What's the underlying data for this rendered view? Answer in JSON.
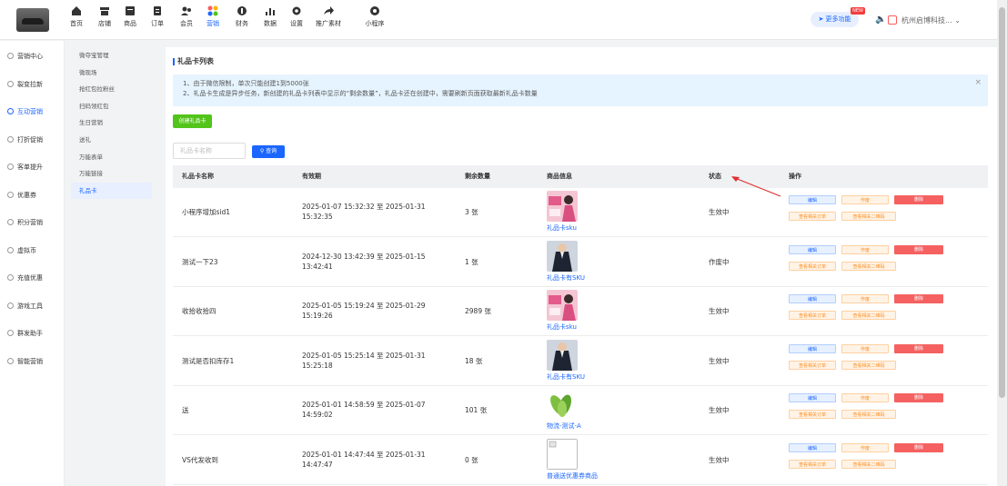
{
  "topnav": {
    "items": [
      {
        "label": "首页",
        "icon": "home-icon"
      },
      {
        "label": "店铺",
        "icon": "store-icon"
      },
      {
        "label": "商品",
        "icon": "goods-icon"
      },
      {
        "label": "订单",
        "icon": "order-icon"
      },
      {
        "label": "会员",
        "icon": "member-icon"
      },
      {
        "label": "营销",
        "icon": "marketing-icon"
      },
      {
        "label": "财务",
        "icon": "finance-icon"
      },
      {
        "label": "数据",
        "icon": "data-icon"
      },
      {
        "label": "设置",
        "icon": "settings-icon"
      },
      {
        "label": "推广素材",
        "icon": "share-icon"
      },
      {
        "label": "小程序",
        "icon": "miniprogram-icon"
      }
    ],
    "active_index": 5,
    "more_label": "更多功能",
    "new_badge": "NEW",
    "shop_name": "杭州启博科技..."
  },
  "sidebar": {
    "items": [
      "营销中心",
      "裂变拉新",
      "互动营销",
      "打折促销",
      "客单提升",
      "优惠券",
      "积分营销",
      "虚拟币",
      "充值优惠",
      "游戏工具",
      "群发助手",
      "智能营销"
    ],
    "active_index": 2
  },
  "subnav": {
    "items": [
      "微夺宝管理",
      "微现场",
      "抢红包拉粉丝",
      "扫码领红包",
      "生日营销",
      "送礼",
      "万能表单",
      "万能链接",
      "礼品卡"
    ],
    "active_index": 8
  },
  "page": {
    "title": "礼品卡列表",
    "notice_line1": "1、由于微信限制，单次只能创建1到5000张",
    "notice_line2": "2、礼品卡生成是异步任务，新创建的礼品卡列表中显示的“剩余数量”，礼品卡还在创建中，需要刷新页面获取最新礼品卡数量",
    "create_button": "创建礼品卡",
    "search_placeholder": "礼品卡名称",
    "search_button": "查询"
  },
  "table": {
    "headers": [
      "礼品卡名称",
      "有效期",
      "剩余数量",
      "商品信息",
      "状态",
      "操作"
    ],
    "action_labels": {
      "edit": "编辑",
      "void": "作废",
      "delete": "删除",
      "orders": "查看相关订单",
      "qr": "查看相关二维码"
    },
    "rows": [
      {
        "name": "小程序增加sid1",
        "validity": "2025-01-07 15:32:32 至 2025-01-31 15:32:35",
        "quantity": "3 张",
        "product": "礼品卡sku",
        "thumb": "pink-model",
        "status": "生效中"
      },
      {
        "name": "测试一下23",
        "validity": "2024-12-30 13:42:39 至 2025-01-15 13:42:41",
        "quantity": "1 张",
        "product": "礼品卡有SKU",
        "thumb": "dark-suit",
        "status": "作废中"
      },
      {
        "name": "收拾收拾四",
        "validity": "2025-01-05 15:19:24 至 2025-01-29 15:19:26",
        "quantity": "2989 张",
        "product": "礼品卡sku",
        "thumb": "pink-model",
        "status": "生效中"
      },
      {
        "name": "测试是否扣库存1",
        "validity": "2025-01-05 15:25:14 至 2025-01-31 15:25:18",
        "quantity": "18 张",
        "product": "礼品卡有SKU",
        "thumb": "dark-suit",
        "status": "生效中"
      },
      {
        "name": "送",
        "validity": "2025-01-01 14:58:59 至 2025-01-07 14:59:02",
        "quantity": "101 张",
        "product": "物流-测试-A",
        "thumb": "green-vegetable",
        "status": "生效中"
      },
      {
        "name": "VS代发收到",
        "validity": "2025-01-01 14:47:44 至 2025-01-31 14:47:47",
        "quantity": "0 张",
        "product": "普通送优惠券商品",
        "thumb": "broken-image",
        "status": "生效中"
      }
    ]
  },
  "colors": {
    "primary": "#1a66ff",
    "success": "#52c41a",
    "danger": "#f56161",
    "warning": "#ff8c1a",
    "annotation": "#e03030"
  }
}
